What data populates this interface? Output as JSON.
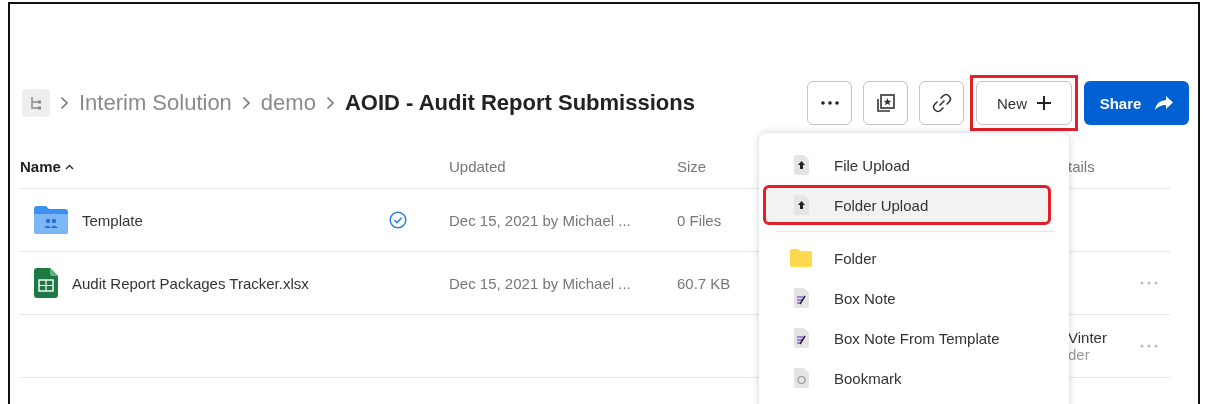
{
  "breadcrumb": [
    {
      "label": "Interim Solution",
      "current": false
    },
    {
      "label": "demo",
      "current": false
    },
    {
      "label": "AOID - Audit Report Submissions",
      "current": true
    }
  ],
  "toolbar": {
    "new_button": {
      "label": "New",
      "highlighted": true
    },
    "share_button": {
      "label": "Share"
    }
  },
  "table": {
    "columns": [
      {
        "label": "Name",
        "sorted": true
      },
      {
        "label": "Updated",
        "sorted": false
      },
      {
        "label": "Size",
        "sorted": false
      },
      {
        "label": "tails",
        "sorted": false
      }
    ],
    "rows": [
      {
        "kind": "folder",
        "name": "Template",
        "synced": true,
        "updated": "Dec 15, 2021 by Michael ...",
        "size": "0 Files",
        "more": false
      },
      {
        "kind": "spreadsheet",
        "name": "Audit Report Packages Tracker.xlsx",
        "synced": false,
        "updated": "Dec 15, 2021 by Michael ...",
        "size": "60.7 KB",
        "more": true
      },
      {
        "kind": "blank",
        "details": "Vinter",
        "details_sub": "der",
        "more": true
      }
    ]
  },
  "menu": {
    "items": [
      {
        "kind": "upload",
        "label": "File Upload",
        "selected": false,
        "highlighted": false,
        "divider_after": false
      },
      {
        "kind": "upload",
        "label": "Folder Upload",
        "selected": true,
        "highlighted": true,
        "divider_after": true
      },
      {
        "kind": "folder",
        "label": "Folder",
        "selected": false,
        "highlighted": false,
        "divider_after": false
      },
      {
        "kind": "note",
        "label": "Box Note",
        "selected": false,
        "highlighted": false,
        "divider_after": false
      },
      {
        "kind": "note",
        "label": "Box Note From Template",
        "selected": false,
        "highlighted": false,
        "divider_after": false
      },
      {
        "kind": "bookmark",
        "label": "Bookmark",
        "selected": false,
        "highlighted": false,
        "divider_after": false
      }
    ]
  }
}
